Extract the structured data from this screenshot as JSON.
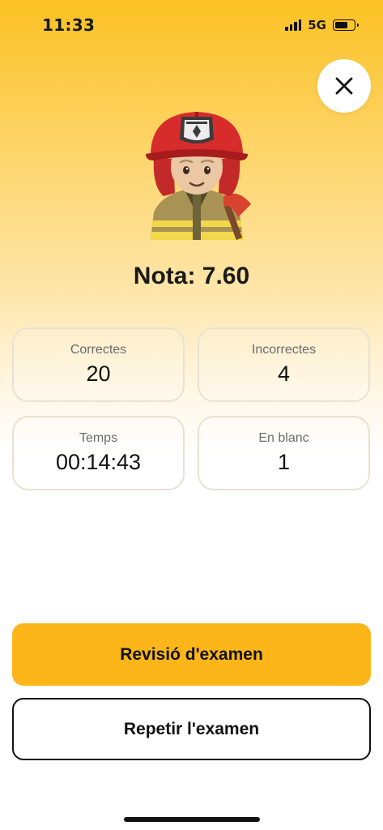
{
  "status_bar": {
    "time": "11:33",
    "network": "5G",
    "battery_level": 0.7,
    "signal_bars": 4
  },
  "close_button": {
    "icon": "close-icon"
  },
  "avatar": {
    "icon": "firefighter-icon"
  },
  "result": {
    "grade_text": "Nota: 7.60"
  },
  "stats": [
    {
      "label": "Correctes",
      "value": "20"
    },
    {
      "label": "Incorrectes",
      "value": "4"
    },
    {
      "label": "Temps",
      "value": "00:14:43"
    },
    {
      "label": "En blanc",
      "value": "1"
    }
  ],
  "actions": {
    "review_label": "Revisió d'examen",
    "repeat_label": "Repetir l'examen"
  },
  "colors": {
    "accent": "#fcb61a",
    "gradient_top": "#fcc123",
    "card_border": "#e9e1d1",
    "text": "#111111",
    "label": "#6b6b6b"
  }
}
